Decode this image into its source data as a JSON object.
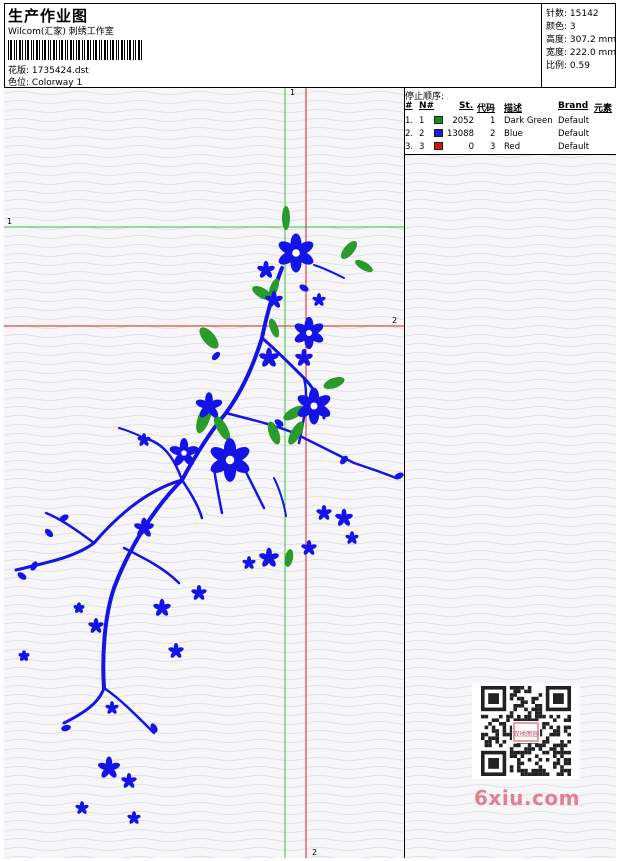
{
  "header": {
    "title": "生产作业图",
    "subtitle": "Wilcom(汇家) 刺绣工作室",
    "design_label": "花版:",
    "design_value": "1735424.dst",
    "colorway_label": "色位:",
    "colorway_value": "Colorway 1"
  },
  "stats": [
    {
      "label": "针数:",
      "value": "15142"
    },
    {
      "label": "颜色:",
      "value": "3"
    },
    {
      "label": "高度:",
      "value": "307.2 mm"
    },
    {
      "label": "宽度:",
      "value": "222.0 mm"
    },
    {
      "label": "比例:",
      "value": "0.59"
    }
  ],
  "stop_sequence": {
    "label": "停止顺序:",
    "columns": [
      "#",
      "N#",
      "St.",
      "代码",
      "描述",
      "Brand",
      "元素"
    ],
    "rows": [
      {
        "num": "1.",
        "n": "1",
        "stitches": "2052",
        "code": "1",
        "desc": "Dark Green",
        "brand": "Default",
        "color": "#1a8a1a"
      },
      {
        "num": "2.",
        "n": "2",
        "stitches": "13088",
        "code": "2",
        "desc": "Blue",
        "brand": "Default",
        "color": "#1a1adc"
      },
      {
        "num": "3.",
        "n": "3",
        "stitches": "0",
        "code": "3",
        "desc": "Red",
        "brand": "Default",
        "color": "#e01010"
      }
    ]
  },
  "guides": {
    "green_label_top": "1",
    "green_label_left": "1",
    "red_label_right": "2",
    "red_label_bottom": "2"
  },
  "colors": {
    "thread_blue": "#1414e6",
    "thread_green": "#2a9a2a",
    "guide_green": "#33cc33",
    "guide_red": "#dd2222"
  },
  "watermark": "6xiu.com",
  "qr_stamp": "双绣图园"
}
